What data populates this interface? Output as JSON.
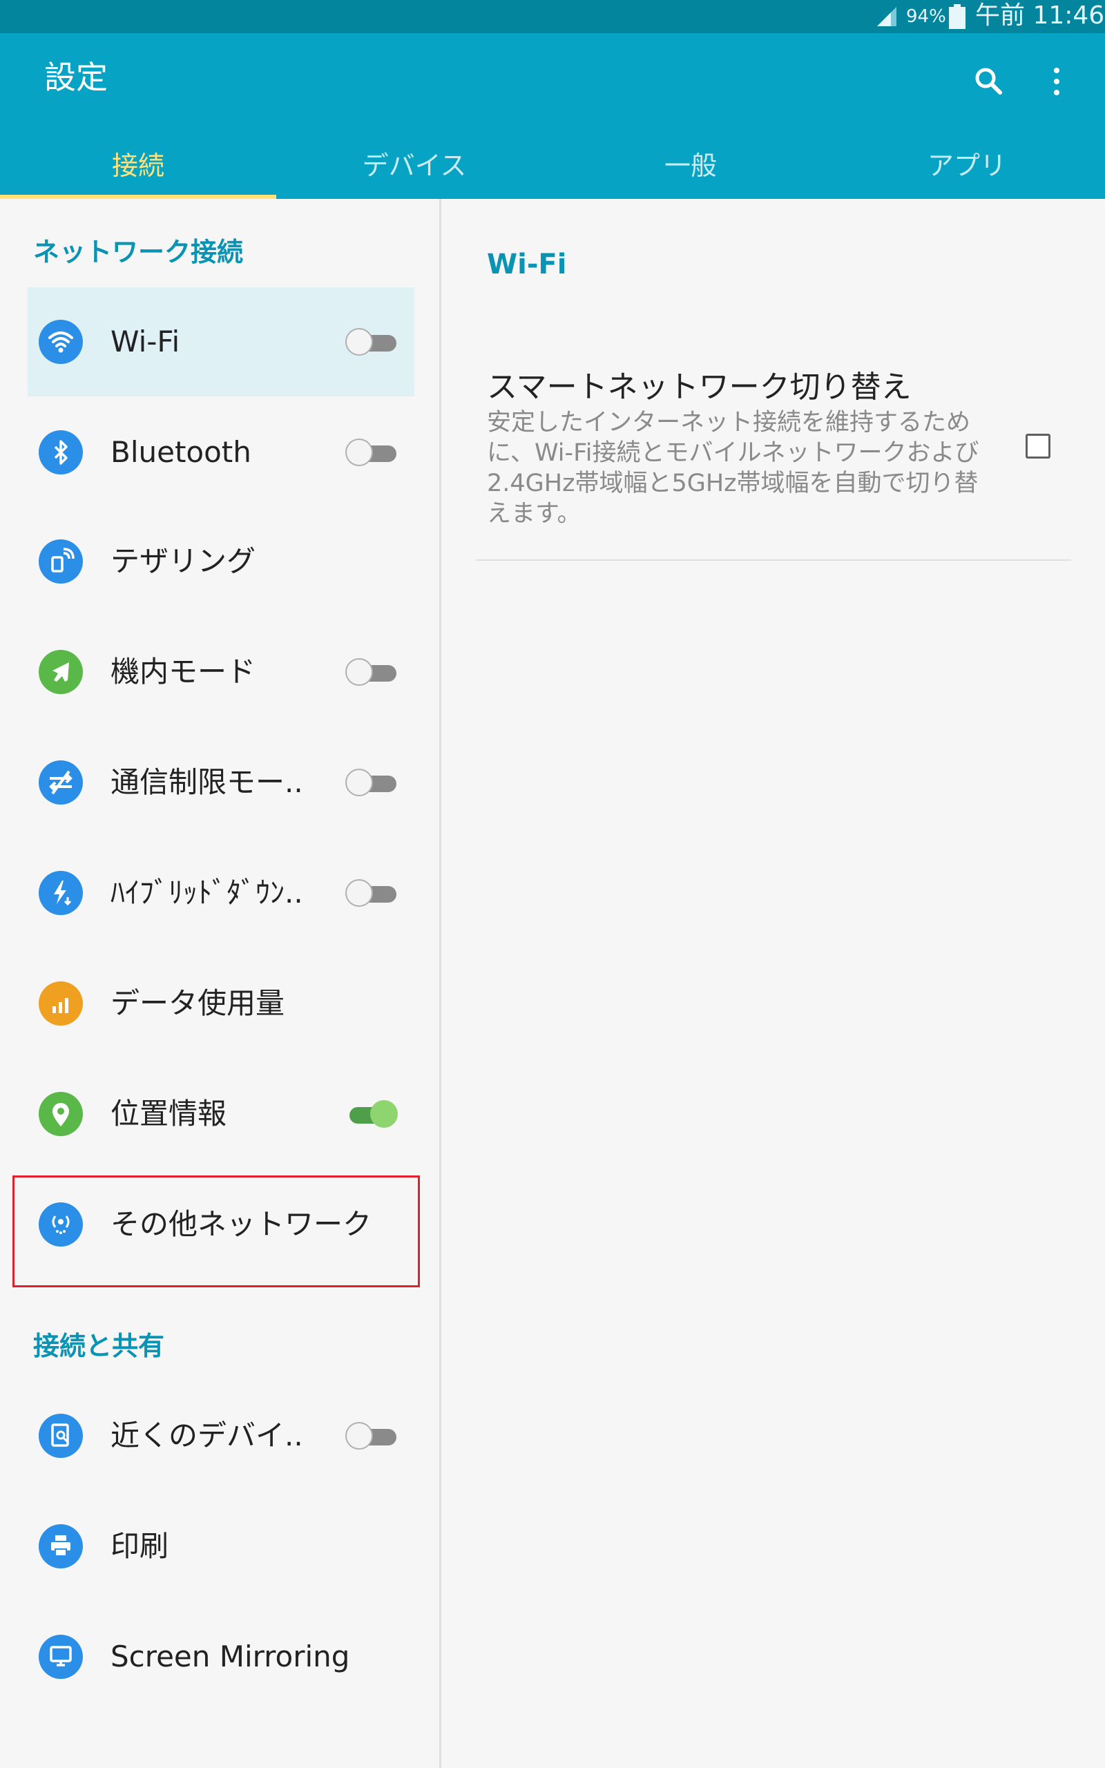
{
  "status_bar": {
    "battery": "94%",
    "time": "午前 11:46"
  },
  "app_bar": {
    "title": "設定",
    "icons": [
      "search-icon",
      "more-vert-icon"
    ]
  },
  "tabs": [
    {
      "label": "接続",
      "active": true
    },
    {
      "label": "デバイス",
      "active": false
    },
    {
      "label": "一般",
      "active": false
    },
    {
      "label": "アプリ",
      "active": false
    }
  ],
  "sections": {
    "network": "ネットワーク接続",
    "connect_share": "接続と共有"
  },
  "items": [
    {
      "label": "Wi-Fi",
      "icon": "wifi-icon",
      "icon_color": "#2b8fe8",
      "toggle": "off",
      "selected": true
    },
    {
      "label": "Bluetooth",
      "icon": "bluetooth-icon",
      "icon_color": "#2b8fe8",
      "toggle": "off"
    },
    {
      "label": "テザリング",
      "icon": "tethering-icon",
      "icon_color": "#2b8fe8",
      "toggle": null
    },
    {
      "label": "機内モード",
      "icon": "airplane-icon",
      "icon_color": "#59b848",
      "toggle": "off"
    },
    {
      "label": "通信制限モー..",
      "icon": "data-saver-icon",
      "icon_color": "#2b8fe8",
      "toggle": "off"
    },
    {
      "label": "ﾊｲﾌﾞﾘｯﾄﾞﾀﾞｳﾝ..",
      "icon": "download-booster-icon",
      "icon_color": "#2b8fe8",
      "toggle": "off"
    },
    {
      "label": "データ使用量",
      "icon": "data-usage-icon",
      "icon_color": "#f0a020",
      "toggle": null
    },
    {
      "label": "位置情報",
      "icon": "location-icon",
      "icon_color": "#59b848",
      "toggle": "on"
    },
    {
      "label": "その他ネットワーク",
      "icon": "more-networks-icon",
      "icon_color": "#2b8fe8",
      "toggle": null,
      "highlighted": true
    },
    {
      "label": "近くのデバイ..",
      "icon": "nearby-devices-icon",
      "icon_color": "#2b8fe8",
      "toggle": "off"
    },
    {
      "label": "印刷",
      "icon": "print-icon",
      "icon_color": "#2b8fe8",
      "toggle": null
    },
    {
      "label": "Screen Mirroring",
      "icon": "screen-mirroring-icon",
      "icon_color": "#2b8fe8",
      "toggle": null
    }
  ],
  "detail": {
    "header": "Wi-Fi",
    "setting_title": "スマートネットワーク切り替え",
    "setting_desc": "安定したインターネット接続を維持するために、Wi-Fi接続とモバイルネットワークおよび2.4GHz帯域幅と5GHz帯域幅を自動で切り替えます。",
    "checked": false
  },
  "colors": {
    "appbar": "#06a3c4",
    "statusbar": "#03859e",
    "accent": "#0b93b3",
    "tab_active": "#ffe27a",
    "highlight": "#e0202a"
  }
}
